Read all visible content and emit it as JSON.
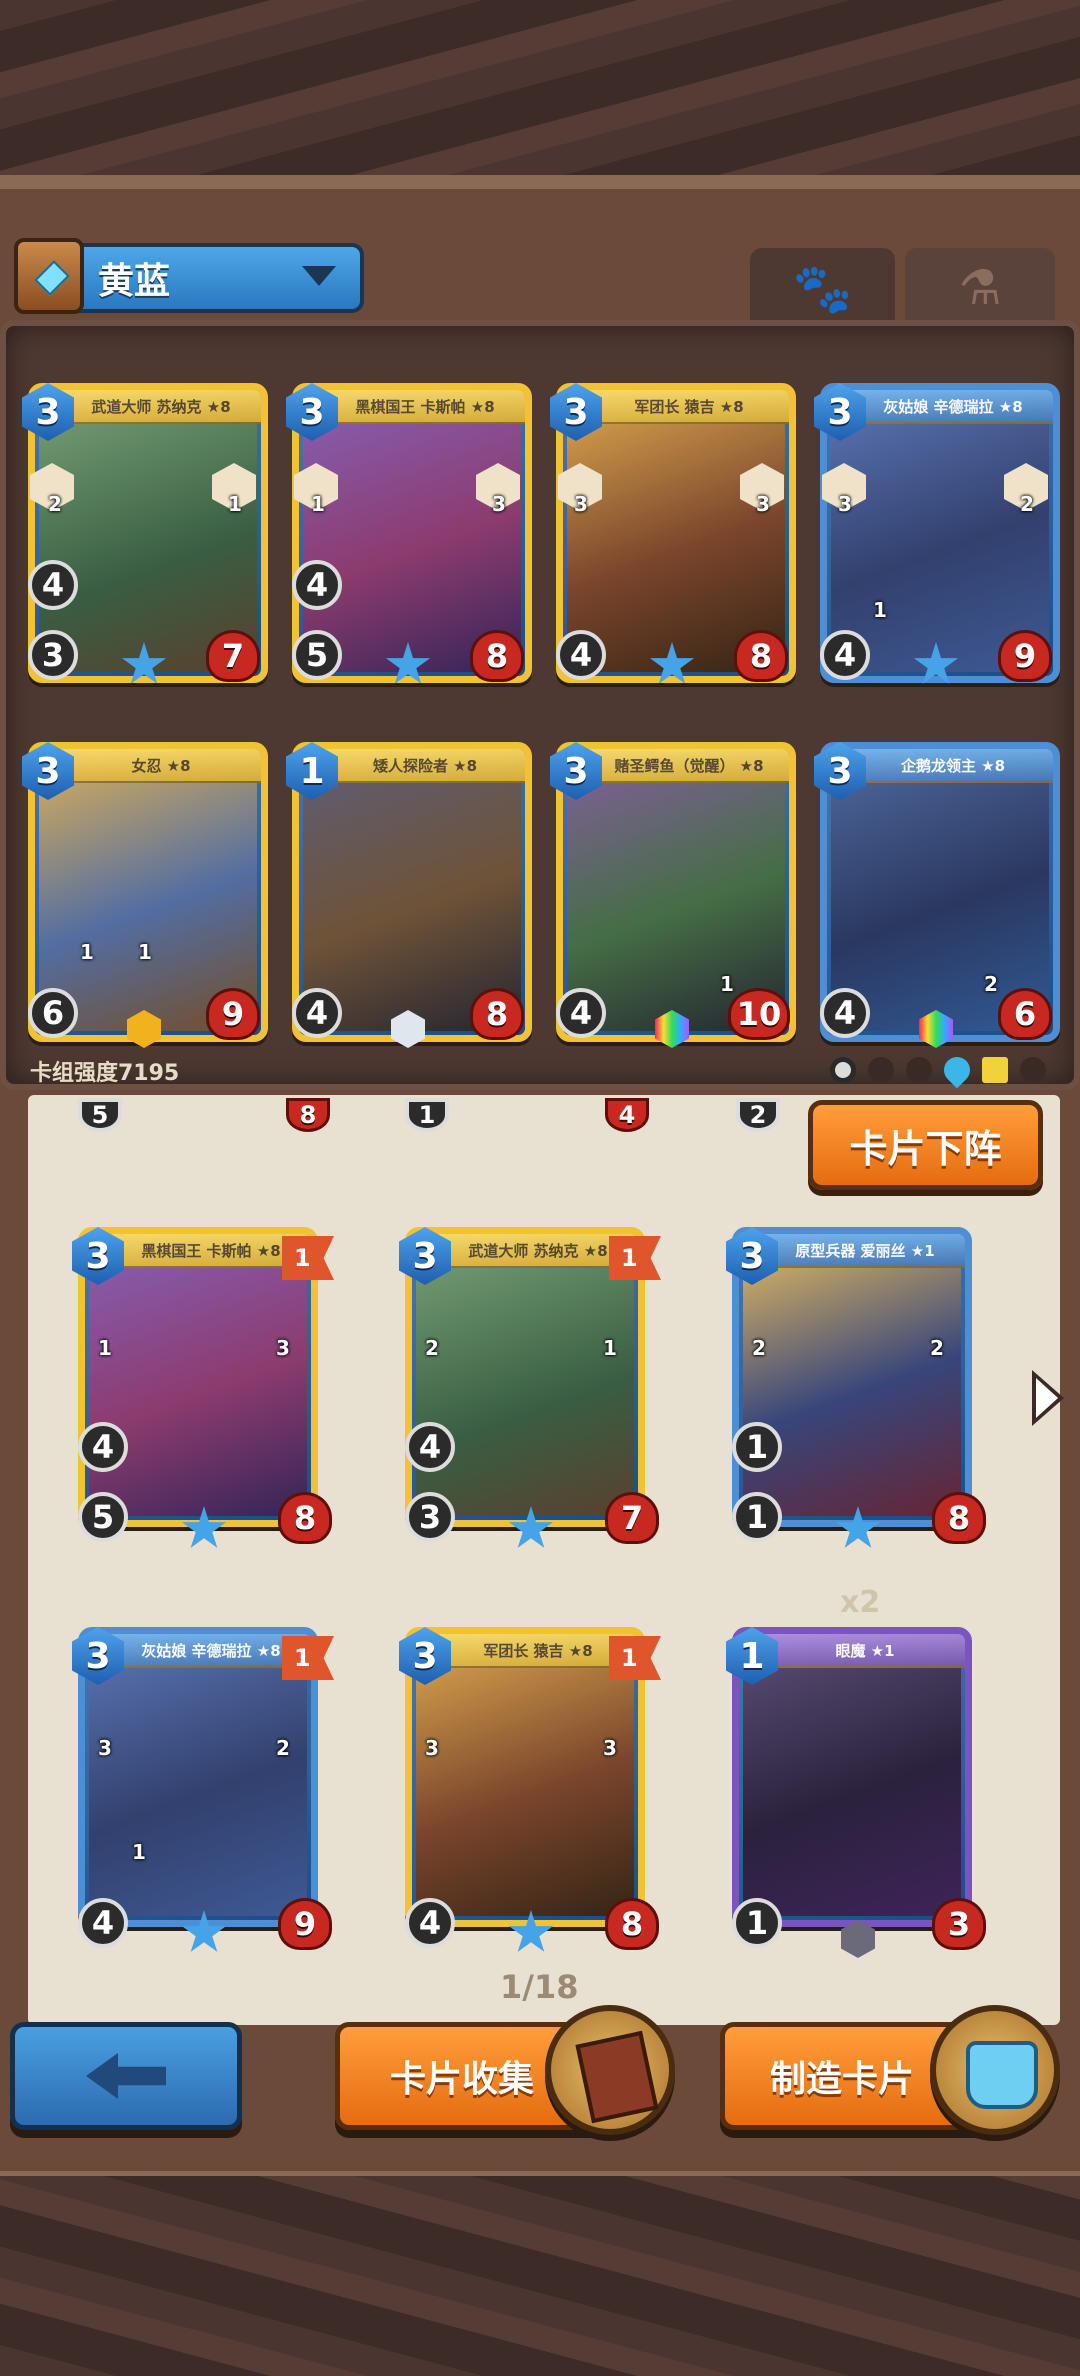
{
  "deck": {
    "name": "黄蓝",
    "strength_label": "卡组强度7195"
  },
  "tabs": [
    {
      "icon": "paw-icon",
      "active": true
    },
    {
      "icon": "potion-icon",
      "active": false
    }
  ],
  "deck_cards": [
    {
      "cost": "3",
      "name": "武道大师 苏纳克 ★8",
      "left": "2",
      "right": "1",
      "atk": "4",
      "def": "3",
      "hp": "7",
      "frame": "gold",
      "gem": "star"
    },
    {
      "cost": "3",
      "name": "黑棋国王 卡斯帕 ★8",
      "left": "1",
      "right": "3",
      "atk": "4",
      "def": "5",
      "hp": "8",
      "frame": "gold",
      "gem": "star"
    },
    {
      "cost": "3",
      "name": "军团长 猿吉 ★8",
      "left": "3",
      "right": "3",
      "atk": "",
      "def": "4",
      "hp": "8",
      "frame": "gold",
      "gem": "star"
    },
    {
      "cost": "3",
      "name": "灰姑娘 辛德瑞拉 ★8",
      "left": "3",
      "right": "2",
      "atk": "",
      "def": "4",
      "hp": "9",
      "frame": "blue",
      "gem": "star",
      "skill_num": "1"
    },
    {
      "cost": "3",
      "name": "女忍 ★8",
      "left": "",
      "right": "",
      "atk": "",
      "def": "6",
      "hp": "9",
      "frame": "gold",
      "gem": "gold",
      "skill_nums": [
        "1",
        "1"
      ]
    },
    {
      "cost": "1",
      "name": "矮人探险者 ★8",
      "left": "",
      "right": "",
      "atk": "",
      "def": "4",
      "hp": "8",
      "frame": "gold",
      "gem": "white"
    },
    {
      "cost": "3",
      "name": "赌圣鳄鱼（觉醒） ★8",
      "left": "",
      "right": "",
      "atk": "",
      "def": "4",
      "hp": "10",
      "frame": "gold",
      "gem": "rainbow",
      "skill_num": "1"
    },
    {
      "cost": "3",
      "name": "企鹅龙领主 ★8",
      "left": "",
      "right": "",
      "atk": "",
      "def": "4",
      "hp": "6",
      "frame": "blue",
      "gem": "rainbow",
      "skill_num": "2"
    }
  ],
  "partial_row": [
    "5",
    "8",
    "1",
    "4",
    "2"
  ],
  "buttons": {
    "remove": "卡片下阵",
    "collect": "卡片收集",
    "craft": "制造卡片"
  },
  "collection_cards": [
    {
      "cost": "3",
      "name": "黑棋国王 卡斯帕 ★8",
      "flag": "1",
      "left": "1",
      "right": "3",
      "atk": "4",
      "def": "5",
      "hp": "8",
      "frame": "gold"
    },
    {
      "cost": "3",
      "name": "武道大师 苏纳克 ★8",
      "flag": "1",
      "left": "2",
      "right": "1",
      "atk": "4",
      "def": "3",
      "hp": "7",
      "frame": "gold"
    },
    {
      "cost": "3",
      "name": "原型兵器 爱丽丝 ★1",
      "flag": "1",
      "left": "2",
      "right": "2",
      "atk": "1",
      "def": "1",
      "hp": "8",
      "frame": "blue"
    },
    {
      "cost": "3",
      "name": "灰姑娘 辛德瑞拉 ★8",
      "flag": "1",
      "left": "3",
      "right": "2",
      "atk": "",
      "def": "4",
      "hp": "9",
      "frame": "blue",
      "skill_num": "1"
    },
    {
      "cost": "3",
      "name": "军团长 猿吉 ★8",
      "flag": "1",
      "left": "3",
      "right": "3",
      "atk": "",
      "def": "4",
      "hp": "8",
      "frame": "gold"
    },
    {
      "cost": "1",
      "name": "眼魔 ★1",
      "flag": "",
      "left": "",
      "right": "",
      "atk": "",
      "def": "1",
      "hp": "3",
      "frame": "purple"
    }
  ],
  "count_label": "x2",
  "page_indicator": "1/18",
  "colors": {
    "gold_frame": "#f1c232",
    "blue_frame": "#4c8fd4",
    "purple_frame": "#7a55c2",
    "orange_button": "#e56c10",
    "blue_button": "#2c6bb0"
  }
}
